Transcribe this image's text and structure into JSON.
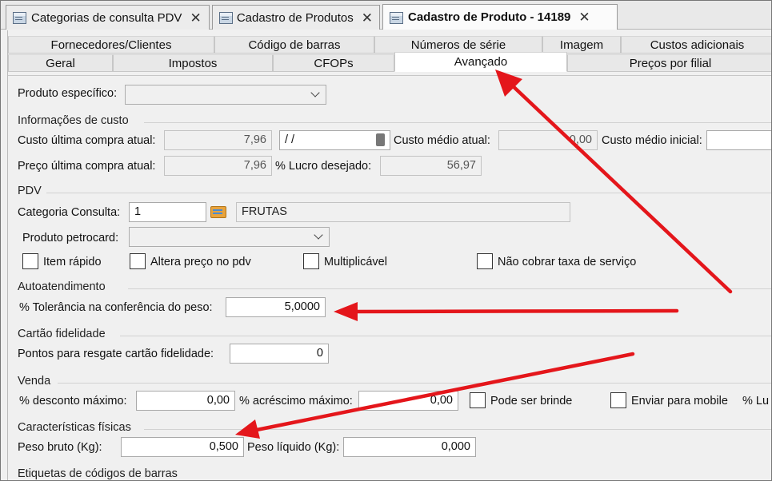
{
  "doc_tabs": [
    {
      "label": "Categorias de consulta PDV",
      "close": "✕"
    },
    {
      "label": "Cadastro de Produtos",
      "close": "✕"
    },
    {
      "label": "Cadastro de Produto - 14189",
      "close": "✕"
    }
  ],
  "property_tabs_row1": [
    "Fornecedores/Clientes",
    "Código de barras",
    "Números de série",
    "Imagem",
    "Custos adicionais"
  ],
  "property_tabs_row2": [
    "Geral",
    "Impostos",
    "CFOPs",
    "Avançado",
    "Preços por filial"
  ],
  "active_tab": "Avançado",
  "produto_especifico": {
    "label": "Produto específico:",
    "value": ""
  },
  "informacoes_custo": {
    "title": "Informações de custo",
    "custo_ultima_compra_label": "Custo última compra atual:",
    "custo_ultima_compra_value": "7,96",
    "data_value": " /  /",
    "custo_medio_atual_label": "Custo médio atual:",
    "custo_medio_atual_value": "0,00",
    "custo_medio_inicial_label": "Custo médio inicial:",
    "custo_medio_inicial_value": "",
    "preco_ultima_compra_label": "Preço última compra atual:",
    "preco_ultima_compra_value": "7,96",
    "lucro_desejado_label": "% Lucro desejado:",
    "lucro_desejado_value": "56,97"
  },
  "pdv": {
    "title": "PDV",
    "categoria_label": "Categoria Consulta:",
    "categoria_code": "1",
    "categoria_desc": "FRUTAS",
    "petrocard_label": "Produto petrocard:",
    "petrocard_value": "",
    "checks": [
      "Item rápido",
      "Altera preço no pdv",
      "Multiplicável",
      "Não cobrar taxa de serviço"
    ]
  },
  "autoatendimento": {
    "title": "Autoatendimento",
    "tolerancia_label": "% Tolerância na conferência do peso:",
    "tolerancia_value": "5,0000"
  },
  "cartao_fidelidade": {
    "title": "Cartão fidelidade",
    "pontos_label": "Pontos para resgate cartão fidelidade:",
    "pontos_value": "0"
  },
  "venda": {
    "title": "Venda",
    "desconto_label": "% desconto máximo:",
    "desconto_value": "0,00",
    "acrescimo_label": "% acréscimo máximo:",
    "acrescimo_value": "0,00",
    "brinde_label": "Pode ser brinde",
    "mobile_label": "Enviar para mobile",
    "cut_label": "% Lu"
  },
  "caracteristicas": {
    "title": "Características físicas",
    "peso_bruto_label": "Peso bruto (Kg):",
    "peso_bruto_value": "0,500",
    "peso_liquido_label": "Peso líquido (Kg):",
    "peso_liquido_value": "0,000"
  },
  "etiquetas": {
    "title": "Etiquetas de códigos de barras"
  },
  "colors": {
    "annotation_arrow": "#e4161b",
    "active_tab_bg": "#ffffff",
    "tab_bg": "#e8e8e8"
  }
}
